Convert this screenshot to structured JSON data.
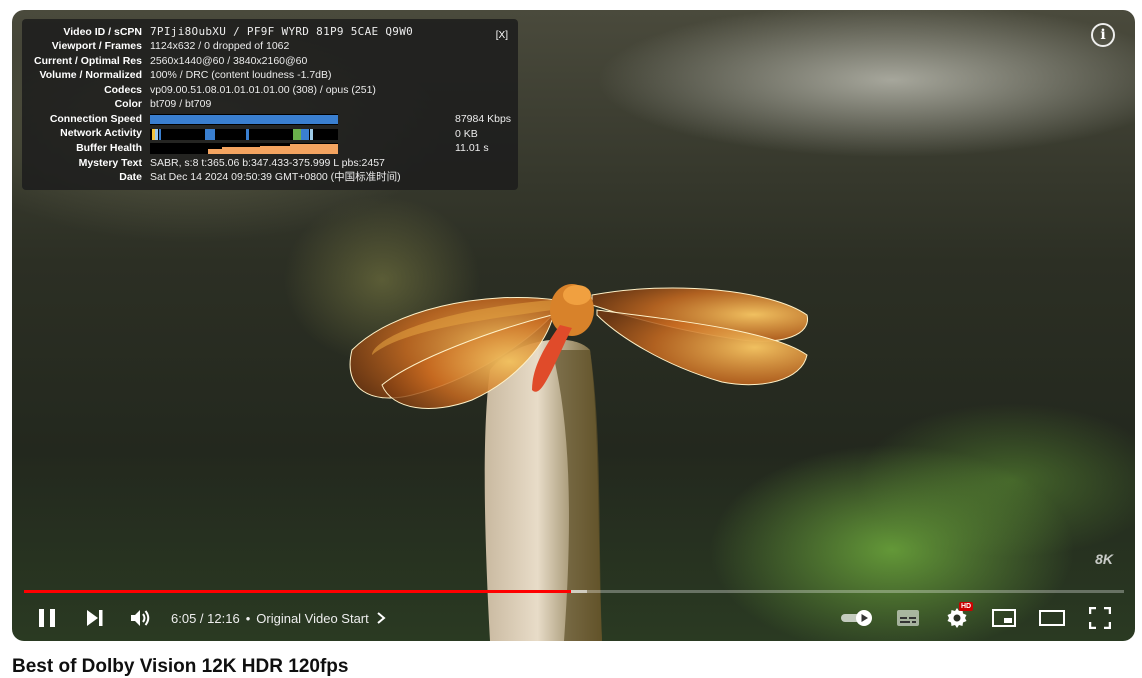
{
  "stats": {
    "close_label": "[X]",
    "rows": [
      {
        "label": "Video ID / sCPN",
        "value": "7PIji8OubXU / PF9F WYRD 81P9 5CAE Q9W0"
      },
      {
        "label": "Viewport / Frames",
        "value": "1124x632 / 0 dropped of 1062"
      },
      {
        "label": "Current / Optimal Res",
        "value": "2560x1440@60 / 3840x2160@60"
      },
      {
        "label": "Volume / Normalized",
        "value": "100% / DRC (content loudness -1.7dB)"
      },
      {
        "label": "Codecs",
        "value": "vp09.00.51.08.01.01.01.01.00 (308) / opus (251)"
      },
      {
        "label": "Color",
        "value": "bt709 / bt709"
      },
      {
        "label": "Connection Speed",
        "value": "87984 Kbps"
      },
      {
        "label": "Network Activity",
        "value": "0 KB"
      },
      {
        "label": "Buffer Health",
        "value": "11.01 s"
      },
      {
        "label": "Mystery Text",
        "value": "SABR, s:8 t:365.06 b:347.433-375.999 L pbs:2457"
      },
      {
        "label": "Date",
        "value": "Sat Dec 14 2024 09:50:39 GMT+0800 (中国标准时间)"
      }
    ]
  },
  "player": {
    "watermark": "8K",
    "time_current": "6:05",
    "time_separator": " / ",
    "time_total": "12:16",
    "chapter": "Original Video Start",
    "progress_played_fraction": 0.497,
    "progress_buffered_fraction": 0.512,
    "hd_badge": "HD",
    "icons": [
      "pause-icon",
      "next-icon",
      "volume-icon",
      "chevron-right-icon",
      "autoplay-toggle-icon",
      "subtitles-icon",
      "gear-icon",
      "miniplayer-icon",
      "theater-icon",
      "fullscreen-icon",
      "info-icon"
    ]
  },
  "colors": {
    "progress_red": "#ff0000",
    "connection_bar": "#3a7fd0",
    "buffer_area": "#f4a460"
  },
  "video_title": "Best of Dolby Vision 12K HDR 120fps"
}
